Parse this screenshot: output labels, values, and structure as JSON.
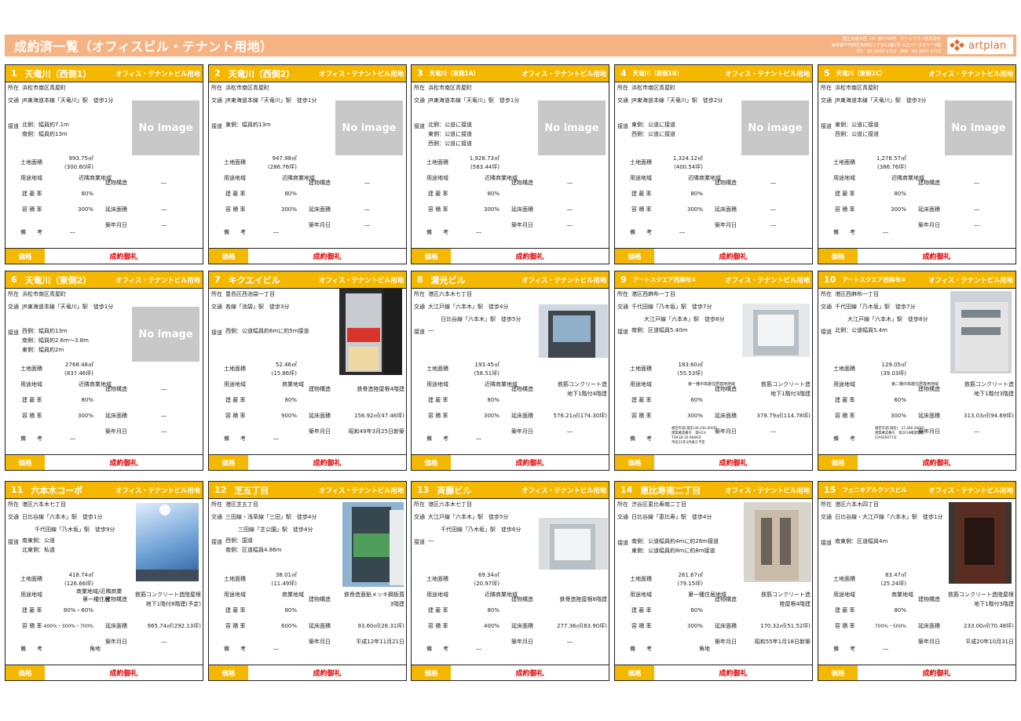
{
  "header": {
    "title": "成約済一覧（オフィスビル・テナント用地）",
    "info_line1": "国土交通大臣（4）第7758号　アートプラン株式会社",
    "info_line2": "東京都千代田区永田町二丁目11番1号 山王パークタワー3階",
    "info_line3": "TEL　03-3507-1711　FAX　03-3507-1712",
    "logo_text": "artplan"
  },
  "labels": {
    "location": "所在",
    "traffic": "交通",
    "access": "接道",
    "land_area": "土地面積",
    "zoning": "用途地域",
    "coverage": "建 蔽 率",
    "far": "容 積 率",
    "remarks": "備　　考",
    "structure": "建物構造",
    "floor_area": "延床面積",
    "built": "築年月日",
    "price": "価格",
    "no_image": "No image"
  },
  "colors": {
    "header_bg": "#f5b383",
    "card_head": "#f5b800",
    "price_text": "#e00000"
  },
  "cards": [
    {
      "num": "1",
      "name": "天竜川（西側1）",
      "category": "オフィス・テナントビル用地",
      "location": "浜松市南区青屋町",
      "traffic1": "JR東海道本線「天竜川」駅　徒歩1分",
      "traffic2": "",
      "access1": "北側：幅員約7.1m",
      "access2": "南側：幅員約13m",
      "access3": "",
      "area_m2": "993.75㎡",
      "area_tsubo": "(300.60坪)",
      "zoning": "近隣商業地域",
      "coverage": "80%",
      "far": "300%",
      "structure": "―",
      "floor_area": "―",
      "built": "―",
      "remarks": "―",
      "price": "成約御礼"
    },
    {
      "num": "2",
      "name": "天竜川（西側2）",
      "category": "オフィス・テナントビル用地",
      "location": "浜松市南区青屋町",
      "traffic1": "JR東海道本線「天竜川」駅　徒歩1分",
      "traffic2": "",
      "access1": "東側：幅員約13m",
      "access2": "",
      "access3": "",
      "area_m2": "947.98㎡",
      "area_tsubo": "(286.76坪)",
      "zoning": "近隣商業地域",
      "coverage": "80%",
      "far": "300%",
      "structure": "―",
      "floor_area": "―",
      "built": "―",
      "remarks": "―",
      "price": "成約御礼"
    },
    {
      "num": "3",
      "name": "天竜川（東側1A）",
      "category": "オフィス・テナントビル用地",
      "location": "浜松市南区青屋町",
      "traffic1": "JR東海道本線「天竜川」駅　徒歩1分",
      "traffic2": "",
      "access1": "北側：公道に接道",
      "access2": "東側：公道に接道",
      "access3": "西側：公道に接道",
      "area_m2": "1,928.73㎡",
      "area_tsubo": "(583.44坪)",
      "zoning": "近隣商業地域",
      "coverage": "80%",
      "far": "300%",
      "structure": "―",
      "floor_area": "―",
      "built": "―",
      "remarks": "―",
      "price": "成約御礼"
    },
    {
      "num": "4",
      "name": "天竜川（東側1B）",
      "category": "オフィス・テナントビル用地",
      "location": "浜松市南区青屋町",
      "traffic1": "JR東海道本線「天竜川」駅　徒歩2分",
      "traffic2": "",
      "access1": "東側：公道に接道",
      "access2": "西側：公道に接道",
      "access3": "",
      "area_m2": "1,324.12㎡",
      "area_tsubo": "(400.54坪)",
      "zoning": "近隣商業地域",
      "coverage": "80%",
      "far": "300%",
      "structure": "―",
      "floor_area": "―",
      "built": "―",
      "remarks": "―",
      "price": "成約御礼"
    },
    {
      "num": "5",
      "name": "天竜川（東側1C）",
      "category": "オフィス・テナントビル用地",
      "location": "浜松市南区青屋町",
      "traffic1": "JR東海道本線「天竜川」駅　徒歩3分",
      "traffic2": "",
      "access1": "東側：公道に接道",
      "access2": "西側：公道に接道",
      "access3": "",
      "area_m2": "1,278.57㎡",
      "area_tsubo": "(386.76坪)",
      "zoning": "近隣商業地域",
      "coverage": "80%",
      "far": "300%",
      "structure": "―",
      "floor_area": "―",
      "built": "―",
      "remarks": "―",
      "price": "成約御礼"
    },
    {
      "num": "6",
      "name": "天竜川（東側2）",
      "category": "オフィス・テナントビル用地",
      "location": "浜松市南区青屋町",
      "traffic1": "JR東海道本線「天竜川」駅　徒歩1分",
      "traffic2": "",
      "access1": "西側：幅員約13m",
      "access2": "南側：幅員約2.6m～3.8m",
      "access3": "東側：幅員約2m",
      "area_m2": "2768.48㎡",
      "area_tsubo": "(837.46坪)",
      "zoning": "近隣商業地域",
      "coverage": "80%",
      "far": "300%",
      "structure": "―",
      "floor_area": "―",
      "built": "―",
      "remarks": "―",
      "price": "成約御礼"
    },
    {
      "num": "7",
      "name": "キクエイビル",
      "category": "オフィス・テナントビル用地",
      "location": "豊島区西池袋一丁目",
      "traffic1": "各線「池袋」駅　徒歩3分",
      "traffic2": "",
      "access1": "西側：公道幅員約6mに約5m接道",
      "access2": "",
      "access3": "",
      "area_m2": "52.46㎡",
      "area_tsubo": "(15.86坪)",
      "zoning": "商業地域",
      "coverage": "80%",
      "far": "900%",
      "structure": "鉄骨造陸屋根4階建",
      "floor_area": "156.92㎡(47.46坪)",
      "built": "昭和49年3月25日新築",
      "remarks": "―",
      "price": "成約御礼"
    },
    {
      "num": "8",
      "name": "清光ビル",
      "category": "オフィス・テナントビル用地",
      "location": "港区六本木七丁目",
      "traffic1": "大江戸線「六本木」駅　徒歩4分",
      "traffic2": "日比谷線「六本木」駅　徒歩5分",
      "access1": "―",
      "access2": "",
      "access3": "",
      "area_m2": "193.45㎡",
      "area_tsubo": "(58.51坪)",
      "zoning": "近隣商業地域",
      "coverage": "80%",
      "far": "300%",
      "structure1": "鉄筋コンクリート造",
      "structure2": "地下1階付4階建",
      "floor_area": "576.21㎡(174.30坪)",
      "built": "―",
      "remarks": "―",
      "price": "成約御礼"
    },
    {
      "num": "9",
      "name": "アートスクエア西麻布①",
      "category": "オフィス・テナントビル用地",
      "location": "港区西麻布一丁目",
      "traffic1": "千代田線「乃木坂」駅　徒歩7分",
      "traffic2": "大江戸線「六本木」駅　徒歩8分",
      "access1": "南側：区道幅員5.40m",
      "access2": "",
      "access3": "",
      "area_m2": "183.60㎡",
      "area_tsubo": "(55.53坪)",
      "zoning": "第一種中高層住居専用地域",
      "coverage": "60%",
      "far": "300%",
      "structure1": "鉄筋コンクリート造",
      "structure2": "地下1階付3階建",
      "floor_area": "378.79㎡(114.78坪)",
      "built": "―",
      "remarks1": "想定年収(満室)39,240,000円",
      "remarks2": "建築確認番号　第H23-",
      "remarks3": "TOK18-10-0666号",
      "remarks4": "平成31年4月竣工予定",
      "price": "成約御礼"
    },
    {
      "num": "10",
      "name": "アートスクエア西麻布②",
      "category": "オフィス・テナントビル用地",
      "location": "港区西麻布一丁目",
      "traffic1": "千代田線「乃木坂」駅　徒歩7分",
      "traffic2": "大江戸線「六本木」駅　徒歩8分",
      "access1": "北側：公道幅員5.4m",
      "access2": "",
      "access3": "",
      "area_m2": "129.05㎡",
      "area_tsubo": "(39.03坪)",
      "zoning": "第二種中高層住居専用地域",
      "coverage": "60%",
      "far": "300%",
      "structure1": "鉄筋コンクリート造",
      "structure2": "地下1階付3階建",
      "floor_area": "313.03㎡(94.69坪)",
      "built": "―",
      "remarks1": "想定年収(満室)　27,480,000円",
      "remarks2": "建築確認番号　第2019確建建築",
      "remarks3": "CIAS00071号",
      "remarks4": "",
      "price": "成約御礼"
    },
    {
      "num": "11",
      "name": "六本木コーポ",
      "category": "オフィス・テナントビル用地",
      "location": "港区六本木七丁目",
      "traffic1": "日比谷線「六本木」駅　徒歩1分",
      "traffic2": "千代田線「乃木坂」駅　徒歩9分",
      "access1": "南東側：公道",
      "access2": "北東側：私道",
      "access3": "",
      "area_m2": "418.74㎡",
      "area_tsubo": "(126.66坪)",
      "zoning1": "商業地域/近隣商業",
      "zoning2": "第一種住居",
      "coverage": "80%・60%",
      "far": "400%・300%・700%",
      "structure1": "鉄筋コンクリート造陸屋根",
      "structure2": "地下1階付8階建(予定)",
      "floor_area": "965.74㎡(292.13坪)",
      "built": "―",
      "remarks": "角地",
      "price": "成約御礼"
    },
    {
      "num": "12",
      "name": "芝五丁目",
      "category": "オフィス・テナントビル用地",
      "location": "港区芝五丁目",
      "traffic1": "三田線・浅草線「三田」駅　徒歩4分",
      "traffic2": "三田線「芝公園」駅　徒歩4分",
      "access1": "西側：国道",
      "access2": "南側：区道幅員4.86m",
      "access3": "",
      "area_m2": "38.01㎡",
      "area_tsubo": "(11.49坪)",
      "zoning": "商業地域",
      "coverage": "80%",
      "far": "600%",
      "structure1": "鉄骨造亜鉛メッキ鋼板葺",
      "structure2": "3階建",
      "floor_area": "93.60㎡(28.31坪)",
      "built": "平成12年11月21日",
      "remarks": "―",
      "price": "成約御礼"
    },
    {
      "num": "13",
      "name": "斉藤ビル",
      "category": "オフィス・テナントビル用地",
      "location": "港区六本木七丁目",
      "traffic1": "大江戸線「六本木」駅　徒歩5分",
      "traffic2": "千代田線「乃木坂」駅　徒歩6分",
      "access1": "―",
      "access2": "",
      "access3": "",
      "area_m2": "69.34㎡",
      "area_tsubo": "(20.97坪)",
      "zoning": "近隣商業地域",
      "coverage": "80%",
      "far": "400%",
      "structure": "鉄骨造陸屋根8階建",
      "floor_area": "277.36㎡(83.90坪)",
      "built": "―",
      "remarks": "―",
      "price": "成約御礼"
    },
    {
      "num": "14",
      "name": "恵比寿南二丁目",
      "category": "オフィス・テナントビル用地",
      "location": "渋谷区恵比寿南二丁目",
      "traffic1": "日比谷線「恵比寿」駅　徒歩4分",
      "traffic2": "",
      "access1": "南側：公道幅員約4mに約26m接道",
      "access2": "東側：公道幅員約8mに約8m接道",
      "access3": "",
      "area_m2": "261.67㎡",
      "area_tsubo": "(79.15坪)",
      "zoning": "第一種住居地域",
      "coverage": "60%",
      "far": "300%",
      "structure1": "鉄筋コンクリート造",
      "structure2": "陸屋根4階建",
      "floor_area": "170.32㎡(51.52坪)",
      "built": "昭和55年1月18日新築",
      "remarks": "角地",
      "price": "成約御礼"
    },
    {
      "num": "15",
      "name": "フェニキアルクソスビル",
      "category": "オフィス・テナントビル用地",
      "location": "港区六本木四丁目",
      "traffic1": "日比谷線・大江戸線「六本木」駅　徒歩1分",
      "traffic2": "",
      "access1": "南東側：区道幅員4m",
      "access2": "",
      "access3": "",
      "area_m2": "83.47㎡",
      "area_tsubo": "(25.24坪)",
      "zoning": "商業地域",
      "coverage": "80%",
      "far": "700%・500%",
      "structure1": "鉄筋コンクリート造陸屋根",
      "structure2": "地下1階付3階建",
      "floor_area": "233.00㎡(70.48坪)",
      "built": "平成20年10月31日",
      "remarks": "―",
      "price": "成約御礼"
    }
  ]
}
